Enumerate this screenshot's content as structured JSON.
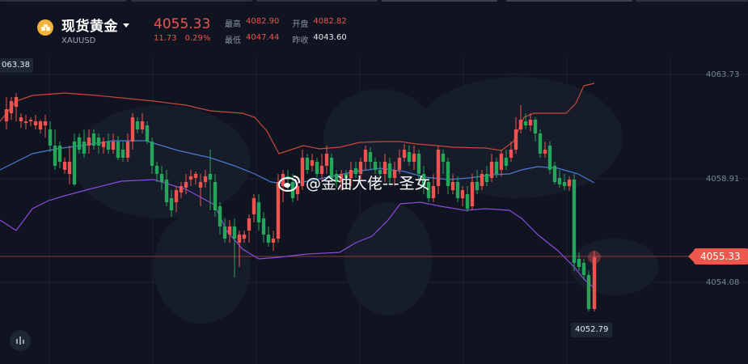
{
  "header": {
    "title": "现货黄金",
    "code": "XAUUSD",
    "price": "4055.33",
    "change": "11.73",
    "change_pct": "0.29%",
    "stats": {
      "high_label": "最高",
      "high_value": "4082.90",
      "open_label": "开盘",
      "open_value": "4082.82",
      "low_label": "最低",
      "low_value": "4047.44",
      "prev_label": "昨收",
      "prev_value": "4043.60"
    }
  },
  "axis": {
    "price_ticks": [
      "4063.73",
      "4058.91",
      "4054.08"
    ]
  },
  "markers": {
    "current_price": "4055.33",
    "low_marker": "4052.79",
    "high_marker": "063.38"
  },
  "watermark": {
    "text": "@金油大佬---圣女",
    "icon": "weibo-icon"
  },
  "colors": {
    "up": "#ef5350",
    "down": "#26a65b",
    "upper_band": "#c8493b",
    "middle_band": "#4a7bd6",
    "lower_band": "#8a4be0",
    "gold": "#f3b23b"
  }
}
